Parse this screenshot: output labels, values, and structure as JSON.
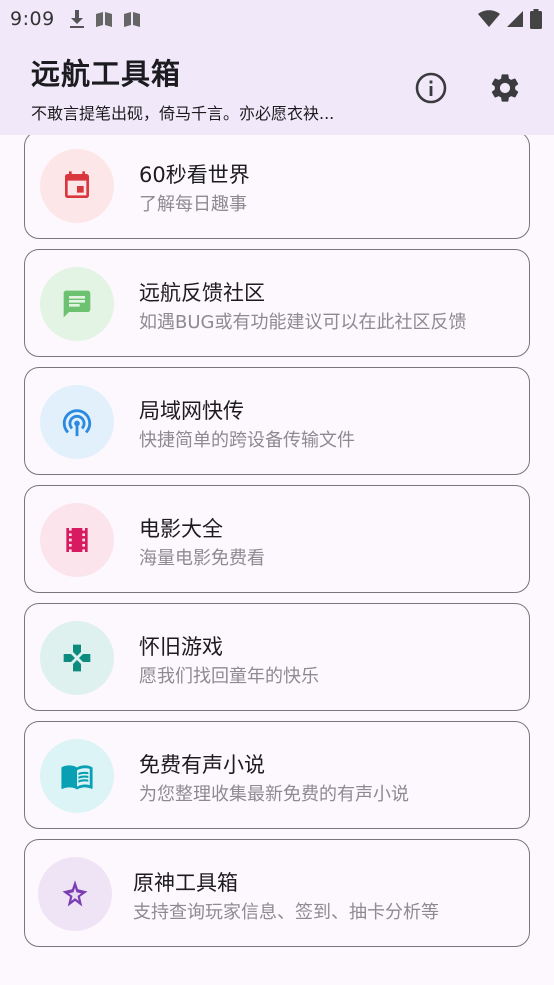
{
  "status_bar": {
    "time": "9:09",
    "left_icons": [
      "download-icon",
      "book-icon",
      "book-icon"
    ],
    "right_icons": [
      "wifi-icon",
      "signal-icon",
      "battery-icon"
    ]
  },
  "app_bar": {
    "title": "远航工具箱",
    "subtitle": "不敢言提笔出砚，倚马千言。亦必愿衣袂...",
    "actions": [
      "info-icon",
      "settings-icon"
    ]
  },
  "cards": [
    {
      "title": "60秒看世界",
      "desc": "了解每日趣事",
      "icon": "calendar-icon",
      "icon_color": "#d9363e",
      "icon_bg": "#fde6e7"
    },
    {
      "title": "远航反馈社区",
      "desc": "如遇BUG或有功能建议可以在此社区反馈",
      "icon": "chat-icon",
      "icon_color": "#6cc270",
      "icon_bg": "#e3f4e4"
    },
    {
      "title": "局域网快传",
      "desc": "快捷简单的跨设备传输文件",
      "icon": "broadcast-icon",
      "icon_color": "#2a8ae0",
      "icon_bg": "#e2f0fc"
    },
    {
      "title": "电影大全",
      "desc": "海量电影免费看",
      "icon": "film-icon",
      "icon_color": "#d81b60",
      "icon_bg": "#fbe4ec"
    },
    {
      "title": "怀旧游戏",
      "desc": "愿我们找回童年的快乐",
      "icon": "gamepad-icon",
      "icon_color": "#0b8c7e",
      "icon_bg": "#dff1ee"
    },
    {
      "title": "免费有声小说",
      "desc": "为您整理收集最新免费的有声小说",
      "icon": "book-open-icon",
      "icon_color": "#0aa0b4",
      "icon_bg": "#ddf4f6"
    },
    {
      "title": "原神工具箱",
      "desc": "支持查询玩家信息、签到、抽卡分析等",
      "icon": "sparkle-icon",
      "icon_color": "#7b3fb2",
      "icon_bg": "#efe4f6"
    }
  ]
}
